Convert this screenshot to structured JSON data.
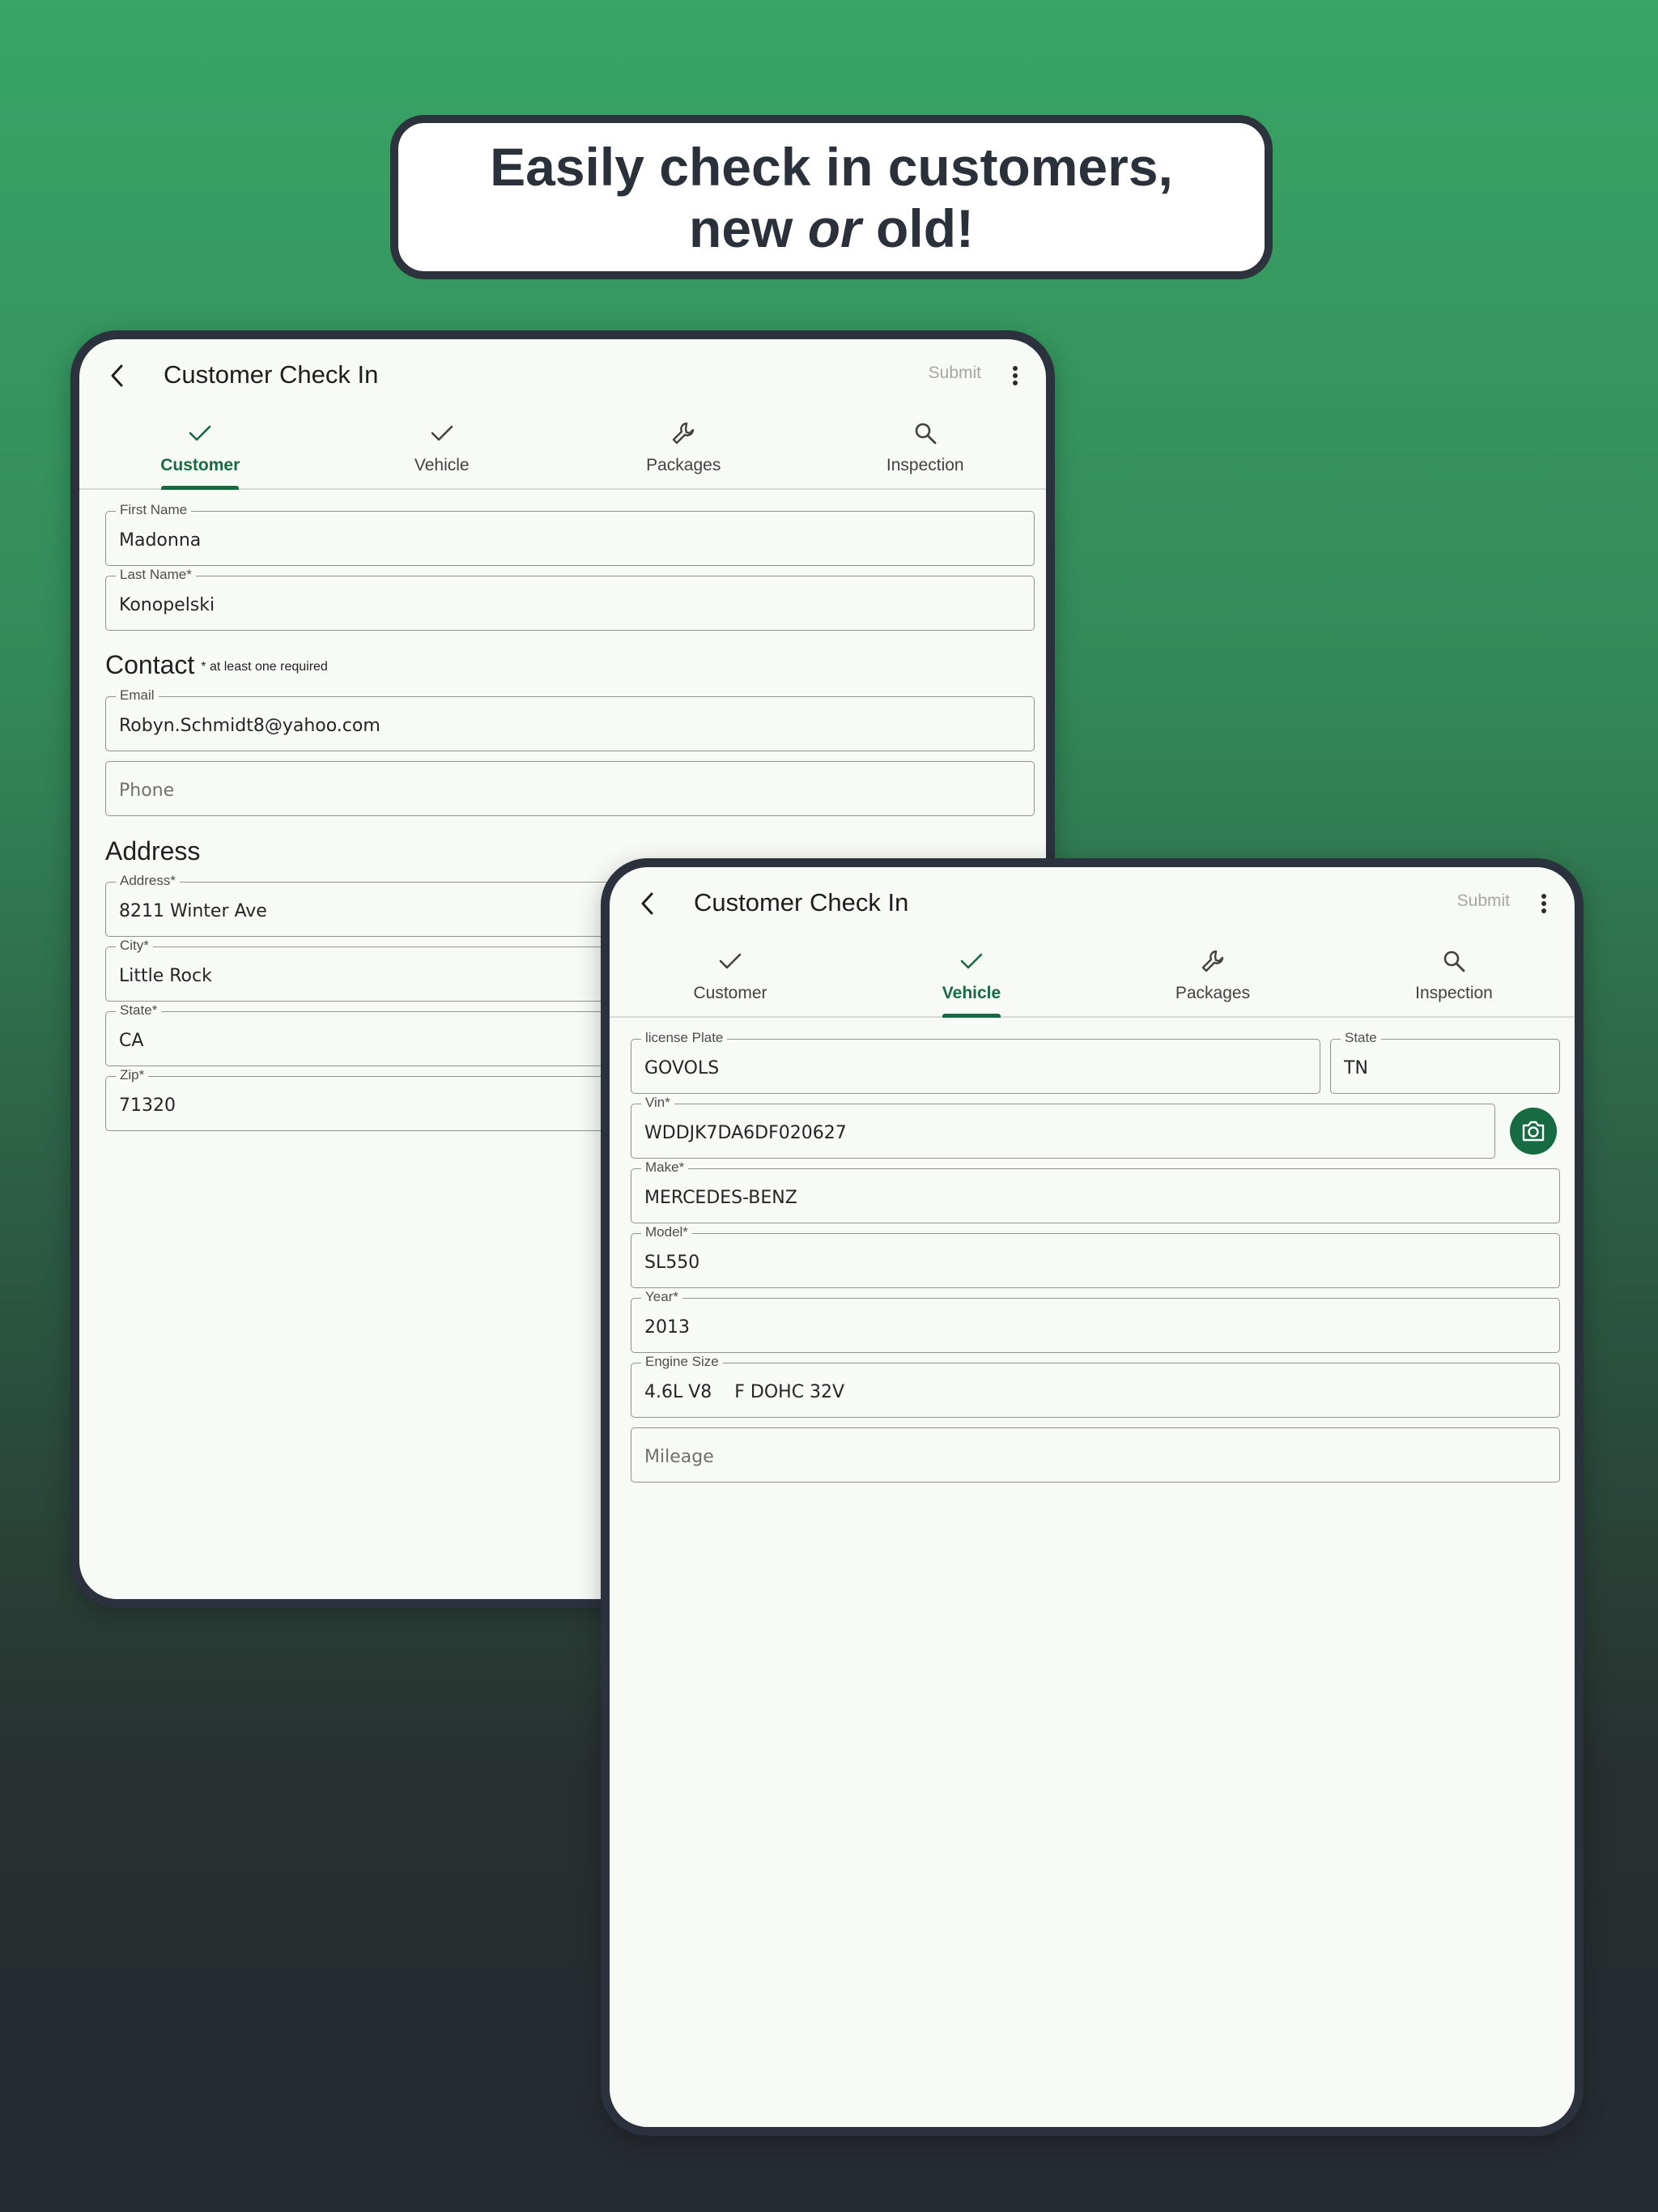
{
  "headline": {
    "line1": "Easily check in customers,",
    "line2_pre": "new ",
    "line2_em": "or",
    "line2_post": " old!"
  },
  "tabs": [
    "Customer",
    "Vehicle",
    "Packages",
    "Inspection"
  ],
  "device1": {
    "title": "Customer Check In",
    "submit": "Submit",
    "active_tab": "Customer",
    "fields": {
      "first_name": {
        "label": "First Name",
        "value": "Madonna"
      },
      "last_name": {
        "label": "Last Name*",
        "value": "Konopelski"
      },
      "email": {
        "label": "Email",
        "value": "Robyn.Schmidt8@yahoo.com"
      },
      "phone": {
        "placeholder": "Phone",
        "value": ""
      },
      "address": {
        "label": "Address*",
        "value": "8211 Winter Ave"
      },
      "city": {
        "label": "City*",
        "value": "Little Rock"
      },
      "state": {
        "label": "State*",
        "value": "CA"
      },
      "zip": {
        "label": "Zip*",
        "value": "71320"
      }
    },
    "contact_title": "Contact",
    "contact_note": "* at least one required",
    "address_title": "Address"
  },
  "device2": {
    "title": "Customer Check In",
    "submit": "Submit",
    "active_tab": "Vehicle",
    "fields": {
      "license_plate": {
        "label": "license Plate",
        "value": "GOVOLS"
      },
      "plate_state": {
        "label": "State",
        "value": "TN"
      },
      "vin": {
        "label": "Vin*",
        "value": "WDDJK7DA6DF020627"
      },
      "make": {
        "label": "Make*",
        "value": "MERCEDES-BENZ"
      },
      "model": {
        "label": "Model*",
        "value": "SL550"
      },
      "year": {
        "label": "Year*",
        "value": "2013"
      },
      "engine": {
        "label": "Engine Size",
        "value": "4.6L V8    F DOHC 32V"
      },
      "mileage": {
        "placeholder": "Mileage",
        "value": ""
      }
    }
  },
  "colors": {
    "accent": "#166b43",
    "frame": "#2b323d",
    "screen": "#f8faf6"
  },
  "icons": {
    "back": "chevron-left-icon",
    "more": "more-vert-icon",
    "customer": "check-icon",
    "vehicle": "check-icon",
    "packages": "wrench-icon",
    "inspection": "search-icon",
    "camera": "camera-icon"
  }
}
